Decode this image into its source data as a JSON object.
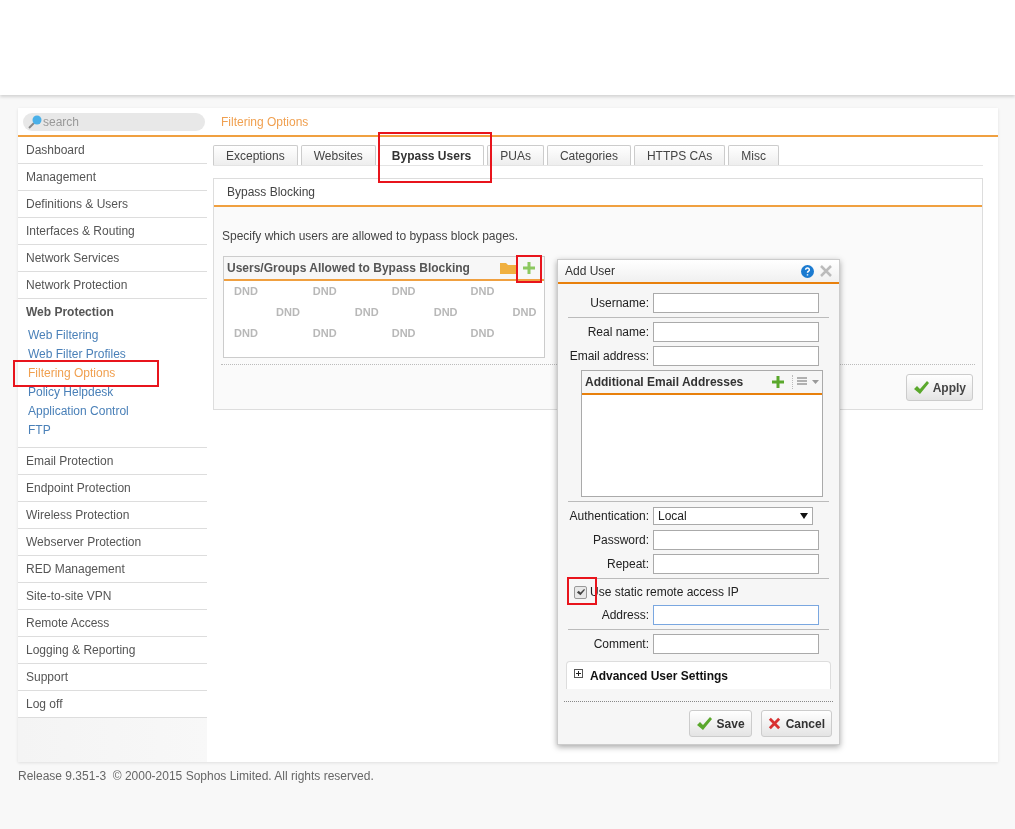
{
  "search": {
    "placeholder": "search"
  },
  "breadcrumb": "Filtering Options",
  "sidebar": {
    "items": [
      {
        "label": "Dashboard",
        "expanded": false
      },
      {
        "label": "Management",
        "expanded": false
      },
      {
        "label": "Definitions & Users",
        "expanded": false
      },
      {
        "label": "Interfaces & Routing",
        "expanded": false
      },
      {
        "label": "Network Services",
        "expanded": false
      },
      {
        "label": "Network Protection",
        "expanded": false
      },
      {
        "label": "Web Protection",
        "expanded": true,
        "children": [
          {
            "label": "Web Filtering",
            "selected": false
          },
          {
            "label": "Web Filter Profiles",
            "selected": false
          },
          {
            "label": "Filtering Options",
            "selected": true
          },
          {
            "label": "Policy Helpdesk",
            "selected": false
          },
          {
            "label": "Application Control",
            "selected": false
          },
          {
            "label": "FTP",
            "selected": false
          }
        ]
      },
      {
        "label": "Email Protection",
        "expanded": false
      },
      {
        "label": "Endpoint Protection",
        "expanded": false
      },
      {
        "label": "Wireless Protection",
        "expanded": false
      },
      {
        "label": "Webserver Protection",
        "expanded": false
      },
      {
        "label": "RED Management",
        "expanded": false
      },
      {
        "label": "Site-to-site VPN",
        "expanded": false
      },
      {
        "label": "Remote Access",
        "expanded": false
      },
      {
        "label": "Logging & Reporting",
        "expanded": false
      },
      {
        "label": "Support",
        "expanded": false
      },
      {
        "label": "Log off",
        "expanded": false
      }
    ]
  },
  "tabs": [
    {
      "label": "Exceptions",
      "selected": false
    },
    {
      "label": "Websites",
      "selected": false
    },
    {
      "label": "Bypass Users",
      "selected": true
    },
    {
      "label": "PUAs",
      "selected": false
    },
    {
      "label": "Categories",
      "selected": false
    },
    {
      "label": "HTTPS CAs",
      "selected": false
    },
    {
      "label": "Misc",
      "selected": false
    }
  ],
  "section": {
    "title": "Bypass Blocking",
    "description": "Specify which users are allowed to bypass block pages.",
    "list": {
      "title": "Users/Groups Allowed to Bypass Blocking",
      "dnd_marks": [
        [
          "DND",
          "DND",
          "DND",
          "DND"
        ],
        [
          "DND",
          "DND",
          "DND",
          "DND"
        ],
        [
          "DND",
          "DND",
          "DND",
          "DND"
        ]
      ]
    },
    "apply_button": "Apply"
  },
  "dialog": {
    "title": "Add User",
    "field_groups": [
      [
        {
          "kind": "text",
          "label": "Username:",
          "focused": false
        }
      ],
      [
        {
          "kind": "text",
          "label": "Real name:",
          "focused": false
        },
        {
          "kind": "text",
          "label": "Email address:",
          "focused": false
        },
        {
          "kind": "sublist",
          "label": "Additional Email Addresses"
        }
      ],
      [
        {
          "kind": "select",
          "label": "Authentication:",
          "value": "Local"
        },
        {
          "kind": "text",
          "label": "Password:",
          "focused": false
        },
        {
          "kind": "text",
          "label": "Repeat:",
          "focused": false
        }
      ],
      [
        {
          "kind": "checkbox",
          "label": "Use static remote access IP",
          "checked": true
        },
        {
          "kind": "text",
          "label": "Address:",
          "focused": true
        }
      ],
      [
        {
          "kind": "text",
          "label": "Comment:",
          "focused": false
        }
      ]
    ],
    "advanced": {
      "label": "Advanced User Settings",
      "expanded": false
    },
    "buttons": [
      {
        "kind": "save",
        "label": "Save"
      },
      {
        "kind": "cancel",
        "label": "Cancel"
      }
    ]
  },
  "footer": "Release 9.351-3  © 2000-2015 Sophos Limited. All rights reserved."
}
